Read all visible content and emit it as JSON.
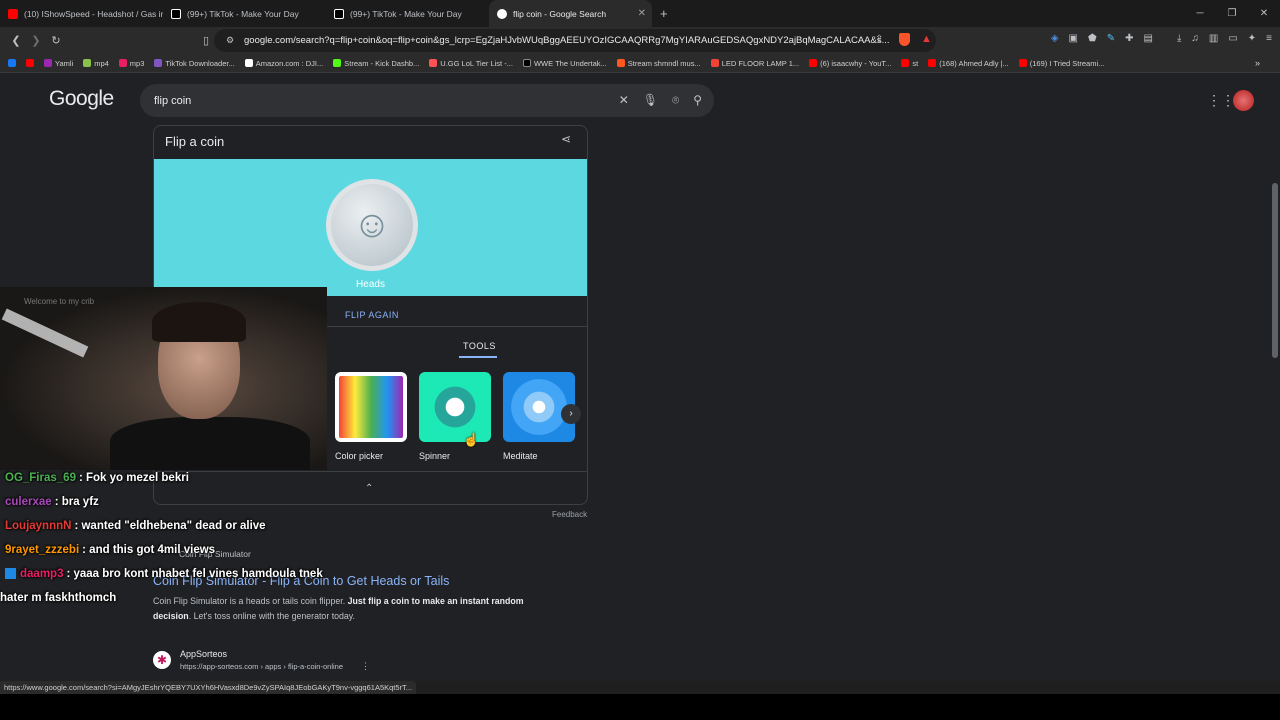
{
  "tabs": [
    {
      "title": "(10) IShowSpeed - Headshot / Gas in",
      "color": "#ff0000"
    },
    {
      "title": "(99+) TikTok - Make Your Day",
      "color": "#ffffff"
    },
    {
      "title": "(99+) TikTok - Make Your Day",
      "color": "#ffffff"
    },
    {
      "title": "flip coin - Google Search",
      "color": "#4285f4",
      "active": true
    }
  ],
  "new_tab_icon": "+",
  "address": "google.com/search?q=flip+coin&oq=flip+coin&gs_lcrp=EgZjaHJvbWUqBggAEEUYOzIGCAAQRRg7MgYIARAuGEDSAQgxNDY2ajBqMagCALACAA&s...",
  "bookmarks": [
    {
      "label": "Yamli",
      "color": "#9c27b0"
    },
    {
      "label": "mp4",
      "color": "#8bc34a"
    },
    {
      "label": "mp3",
      "color": "#e91e63"
    },
    {
      "label": "TikTok Downloader...",
      "color": "#7e57c2"
    },
    {
      "label": "Amazon.com : DJI...",
      "color": "#ffffff"
    },
    {
      "label": "Stream - Kick Dashb...",
      "color": "#53fc18"
    },
    {
      "label": "U.GG LoL Tier List -...",
      "color": "#ff5252"
    },
    {
      "label": "WWE The Undertak...",
      "color": "#000000"
    },
    {
      "label": "Stream shmndl mus...",
      "color": "#ff5722"
    },
    {
      "label": "LED FLOOR LAMP 1...",
      "color": "#f44336"
    },
    {
      "label": "(6) isaacwhy - YouT...",
      "color": "#ff0000"
    },
    {
      "label": "st",
      "color": "#ff0000"
    },
    {
      "label": "(168) Ahmed Adly |...",
      "color": "#ff0000"
    },
    {
      "label": "(169) I Tried Streami...",
      "color": "#ff0000"
    }
  ],
  "google": {
    "logo": "Google",
    "query": "flip coin"
  },
  "coin_card": {
    "title": "Flip a coin",
    "result": "Heads",
    "flip_again": "FLIP AGAIN",
    "tools_label": "TOOLS",
    "tools": [
      {
        "label": "Color picker"
      },
      {
        "label": "Spinner"
      },
      {
        "label": "Meditate"
      }
    ],
    "feedback": "Feedback",
    "accent": "#5cd9e0"
  },
  "result1": {
    "site": "Coin Flip Simulator",
    "title": "Coin Flip Simulator - Flip a Coin to Get Heads or Tails",
    "desc_plain1": "Coin Flip Simulator is a heads or tails coin flipper.",
    "desc_bold": "Just flip a coin to make an instant random decision",
    "desc_plain2": ". Let's toss online with the generator today."
  },
  "result2": {
    "site": "AppSorteos",
    "url": "https://app-sorteos.com › apps › flip-a-coin-online"
  },
  "webcam": {
    "wall_text": "Welcome to my crib"
  },
  "chat": [
    {
      "user": "OG_Firas_69",
      "color": "#4caf50",
      "text": ": Fok yo mezel bekri"
    },
    {
      "user": "culerxae",
      "color": "#9c27b0",
      "text": ": bra yfz"
    },
    {
      "user": "LoujaynnnN",
      "color": "#e53935",
      "text": ": wanted \"eldhebena\" dead or alive"
    },
    {
      "user": "9rayet_zzzebi",
      "color": "#ff9800",
      "text": ": and this got 4mil views"
    },
    {
      "user": "daamp3",
      "color": "#e91e63",
      "text": ": yaaa bro kont nhabet fel vines hamdoula tnek"
    },
    {
      "user": "",
      "color": "#ffffff",
      "text": "hater m faskhthomch"
    }
  ],
  "status_url": "https://www.google.com/search?si=AMgyJEshrYQEBY7UXYh6HVasxd8De9vZySPAIq8JEobGAKyT9nv-vggq61A5Kqt5rT..."
}
